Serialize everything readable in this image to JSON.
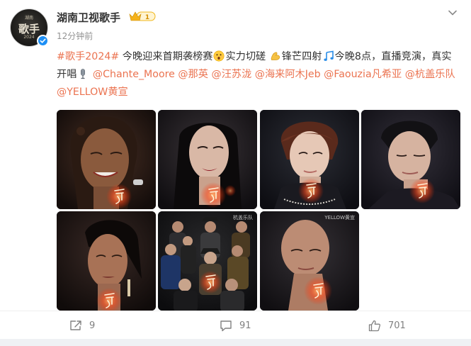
{
  "account": {
    "name": "湖南卫视歌手",
    "time": "12分钟前",
    "vip_level": "1",
    "avatar_text": "歌手",
    "avatar_year": "2024",
    "avatar_top": "湖南"
  },
  "post": {
    "hashtag": "#歌手2024#",
    "line1": " 今晚迎来首期袭榜赛",
    "seg_strength": "实力切磋 ",
    "seg_sharp": "锋芒四射",
    "seg_tonight": "今晚8点，直播竞演，真实开唱",
    "mentions": [
      " @Chante_Moore",
      " @那英",
      " @汪苏泷",
      " @海来阿木Jeb",
      " @Faouzia凡希亚",
      " @杭盖乐队",
      " @YELLOW黄宣"
    ]
  },
  "photos": {
    "watermark_band": "杭盖乐队",
    "watermark_yellow": "YELLOW黄宣"
  },
  "actions": {
    "repost_count": "9",
    "comment_count": "91",
    "like_count": "701"
  },
  "colors": {
    "accent": "#eb7350",
    "verified": "#1d8ff5",
    "text": "#333333",
    "muted": "#939393"
  }
}
